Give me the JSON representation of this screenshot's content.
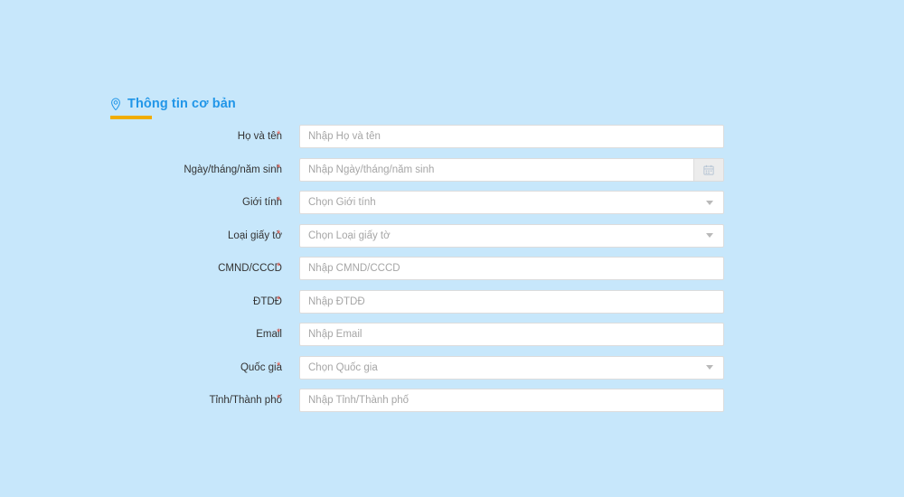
{
  "page": {
    "background_color": "#c7e7fb"
  },
  "section": {
    "icon": "map-pin-icon",
    "title": "Thông tin cơ bản",
    "title_color": "#2196e8",
    "underline_color": "#f0ad00"
  },
  "form": {
    "required_marker": "*",
    "required_marker_color": "#e8564a",
    "fields": [
      {
        "label": "Họ và tên",
        "required": true,
        "type": "text",
        "value": "",
        "placeholder": "Nhập Họ và tên"
      },
      {
        "label": "Ngày/tháng/năm sinh",
        "required": true,
        "type": "date",
        "value": "",
        "placeholder": "Nhập Ngày/tháng/năm sinh",
        "addon_icon": "calendar-icon"
      },
      {
        "label": "Giới tính",
        "required": true,
        "type": "select",
        "value": "",
        "placeholder": "Chọn Giới tính",
        "addon_icon": "chevron-down-icon"
      },
      {
        "label": "Loại giấy tờ",
        "required": true,
        "type": "select",
        "value": "",
        "placeholder": "Chọn Loại giấy tờ",
        "addon_icon": "chevron-down-icon"
      },
      {
        "label": "CMND/CCCD",
        "required": true,
        "type": "text",
        "value": "",
        "placeholder": "Nhập CMND/CCCD"
      },
      {
        "label": "ĐTDĐ",
        "required": true,
        "type": "text",
        "value": "",
        "placeholder": "Nhập ĐTDĐ"
      },
      {
        "label": "Email",
        "required": true,
        "type": "text",
        "value": "",
        "placeholder": "Nhập Email"
      },
      {
        "label": "Quốc gia",
        "required": true,
        "type": "select",
        "value": "",
        "placeholder": "Chọn Quốc gia",
        "addon_icon": "chevron-down-icon"
      },
      {
        "label": "Tỉnh/Thành phố",
        "required": true,
        "type": "text",
        "value": "",
        "placeholder": "Nhập Tỉnh/Thành phố"
      }
    ]
  }
}
